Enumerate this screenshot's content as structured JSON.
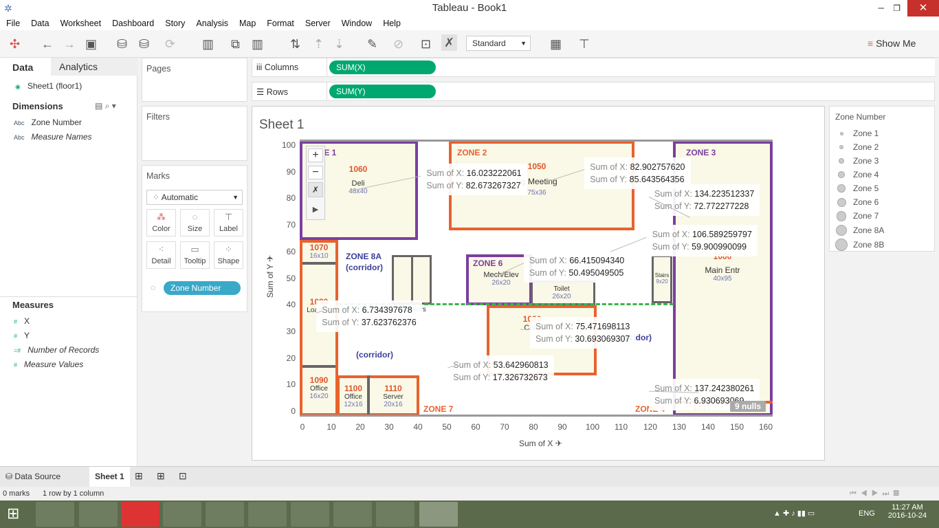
{
  "window": {
    "title": "Tableau - Book1"
  },
  "menu": [
    "File",
    "Data",
    "Worksheet",
    "Dashboard",
    "Story",
    "Analysis",
    "Map",
    "Format",
    "Server",
    "Window",
    "Help"
  ],
  "toolbar": {
    "fit_select": "Standard",
    "show_me": "Show Me"
  },
  "left_pane": {
    "tabs": [
      "Data",
      "Analytics"
    ],
    "datasource": "Sheet1 (floor1)",
    "dimensions_title": "Dimensions",
    "dimensions": [
      {
        "type": "Abc",
        "name": "Zone Number"
      },
      {
        "type": "Abc",
        "name": "Measure Names"
      }
    ],
    "measures_title": "Measures",
    "measures": [
      {
        "type": "#",
        "name": "X"
      },
      {
        "type": "#",
        "name": "Y"
      },
      {
        "type": "=#",
        "name": "Number of Records"
      },
      {
        "type": "#",
        "name": "Measure Values"
      }
    ]
  },
  "cards": {
    "pages": "Pages",
    "filters": "Filters",
    "marks": "Marks",
    "mark_type": "Automatic",
    "mark_buttons": [
      "Color",
      "Size",
      "Label",
      "Detail",
      "Tooltip",
      "Shape"
    ],
    "detail_pill": "Zone Number"
  },
  "shelves": {
    "columns_label": "Columns",
    "columns_pill": "SUM(X)",
    "rows_label": "Rows",
    "rows_pill": "SUM(Y)"
  },
  "sheet": {
    "title": "Sheet 1",
    "x_axis_label": "Sum of X",
    "y_axis_label": "Sum of Y",
    "nulls_badge": "9 nulls",
    "x_ticks": [
      "0",
      "10",
      "20",
      "30",
      "40",
      "50",
      "60",
      "70",
      "80",
      "90",
      "100",
      "110",
      "120",
      "130",
      "140",
      "150",
      "160"
    ],
    "y_ticks": [
      "100",
      "90",
      "80",
      "70",
      "60",
      "50",
      "40",
      "30",
      "20",
      "10",
      "0"
    ]
  },
  "chart_data": {
    "type": "scatter",
    "xlabel": "Sum of X",
    "ylabel": "Sum of Y",
    "xlim": [
      0,
      160
    ],
    "ylim": [
      0,
      100
    ],
    "points": [
      {
        "x": "16.023222061",
        "y": "82.673267327"
      },
      {
        "x": "82.902757620",
        "y": "85.643564356"
      },
      {
        "x": "134.223512337",
        "y": "72.772277228"
      },
      {
        "x": "106.589259797",
        "y": "59.900990099"
      },
      {
        "x": "66.415094340",
        "y": "50.495049505"
      },
      {
        "x": "75.471698113",
        "y": "30.693069307"
      },
      {
        "x": "6.734397678",
        "y": "37.623762376"
      },
      {
        "x": "53.642960813",
        "y": "17.326732673"
      },
      {
        "x": "137.242380261",
        "y": "6.930693069"
      }
    ],
    "ann_prefix_x": "Sum of X:",
    "ann_prefix_y": "Sum of Y:"
  },
  "floorplan": {
    "zones": [
      "ZONE 1",
      "ZONE 2",
      "ZONE 3",
      "ZONE 8A",
      "(corridor)",
      "ZONE 6",
      "(corridor)",
      "(corridor)",
      "ZONE 7",
      "ZONE 4"
    ],
    "rooms": [
      {
        "num": "1060",
        "name": "Deli",
        "dim": "48x40"
      },
      {
        "num": "1050",
        "name": "Lg Meeting",
        "dim": "75x36"
      },
      {
        "num": "1000",
        "name": "Main Entr",
        "dim": "40x95"
      },
      {
        "num": "1070",
        "name": "",
        "dim": "16x10"
      },
      {
        "num": "1080",
        "name": "Loading",
        "dim": ""
      },
      {
        "num": "",
        "name": "Mech/Elev",
        "dim": "26x20"
      },
      {
        "num": "",
        "name": "Toilet",
        "dim": "26x20"
      },
      {
        "num": "1030",
        "name": "Conf",
        "dim": ""
      },
      {
        "num": "",
        "name": "Stairs",
        "dim": "9x20"
      },
      {
        "num": "",
        "name": "Elevators",
        "dim": ""
      },
      {
        "num": "1090",
        "name": "Office",
        "dim": "16x20"
      },
      {
        "num": "1100",
        "name": "Office",
        "dim": "12x16"
      },
      {
        "num": "1110",
        "name": "Server",
        "dim": "20x16"
      },
      {
        "num": "1010",
        "name": "",
        "dim": ""
      }
    ]
  },
  "legend": {
    "title": "Zone Number",
    "items": [
      "Zone 1",
      "Zone 2",
      "Zone 3",
      "Zone 4",
      "Zone 5",
      "Zone 6",
      "Zone 7",
      "Zone 8A",
      "Zone 8B"
    ]
  },
  "tabs": {
    "data_source": "Data Source",
    "sheet": "Sheet 1"
  },
  "status": {
    "marks": "0 marks",
    "dims": "1 row by 1 column"
  },
  "taskbar": {
    "lang": "ENG",
    "time": "11:27 AM",
    "date": "2016-10-24"
  },
  "colors": {
    "pill": "#00a870",
    "zone_purple": "#7b3f9e",
    "zone_orange": "#e8622e",
    "corridor": "#3a3f9a"
  }
}
